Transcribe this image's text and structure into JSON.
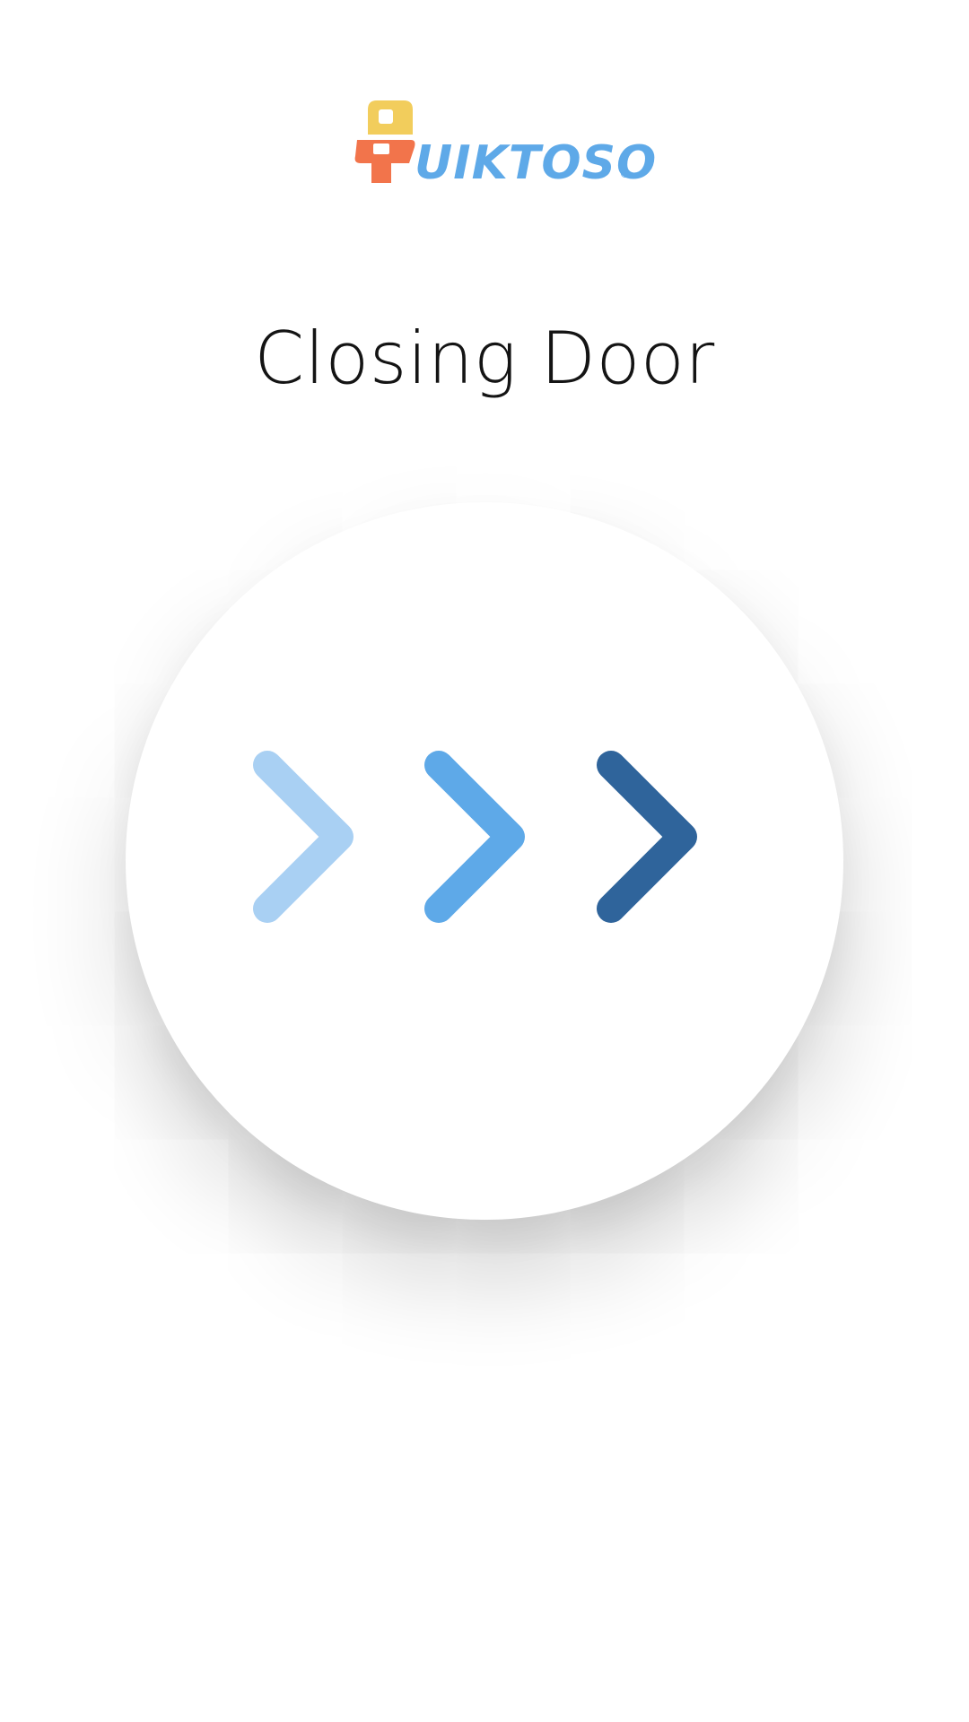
{
  "brand": {
    "wordmark": "UIKTOSO",
    "registered_mark": "®",
    "colors": {
      "yellow": "#f2cd5c",
      "orange": "#f2744b",
      "blue": "#5ea9e8"
    }
  },
  "status": {
    "title": "Closing Door"
  },
  "indicator": {
    "icon": "chevron-right-icon",
    "colors": [
      "#a9d0f3",
      "#5ea9e8",
      "#2f649b"
    ]
  }
}
